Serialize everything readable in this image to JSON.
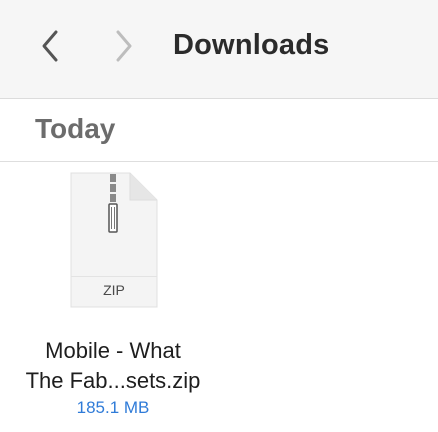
{
  "toolbar": {
    "title": "Downloads",
    "back_icon": "chevron-left-icon",
    "forward_icon": "chevron-right-icon"
  },
  "section": {
    "title": "Today"
  },
  "files": [
    {
      "icon": "zip-file-icon",
      "type_label": "ZIP",
      "name_line1": "Mobile - What",
      "name_line2": "The Fab...sets.zip",
      "size": "185.1 MB"
    }
  ],
  "colors": {
    "toolbar_bg": "#f6f6f6",
    "title_text": "#2b2b2b",
    "section_text": "#6c6c6c",
    "size_text": "#2f7bd8",
    "chevron_back": "#555555",
    "chevron_forward": "#bdbdbd"
  }
}
